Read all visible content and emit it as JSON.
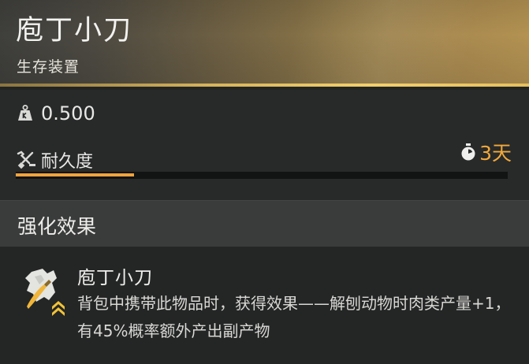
{
  "item": {
    "name": "庖丁小刀",
    "category": "生存装置"
  },
  "stats": {
    "weight_icon": "weight-icon",
    "weight": "0.500",
    "durability_icon": "wrench-icon",
    "durability_label": "耐久度",
    "durability_fraction": 0.24,
    "time_icon": "stopwatch-icon",
    "time_left": "3天"
  },
  "enhancement": {
    "section_title": "强化效果",
    "effect_icon": "knife-chevron-rank-icon",
    "effect_name": "庖丁小刀",
    "effect_description": "背包中携带此物品时，获得效果——解刨动物时肉类产量+1，有45%概率额外产出副产物"
  },
  "colors": {
    "accent_orange": "#f0a33c",
    "header_gold": "#b39252",
    "gold_line": "#f2cf6d",
    "timer_text": "#f2a93b"
  }
}
